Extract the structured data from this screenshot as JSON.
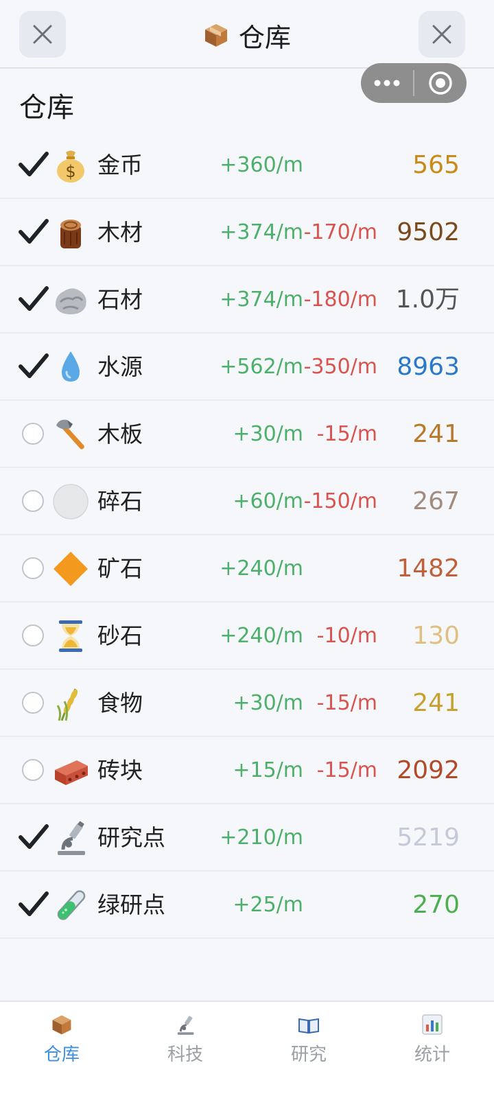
{
  "header": {
    "title": "仓库"
  },
  "section": {
    "title": "仓库"
  },
  "resources": [
    {
      "name": "金币",
      "plus": "+360/m",
      "minus": "",
      "amount": "565",
      "checked": true,
      "amount_color": "#c98a1a",
      "icon": "money-bag-icon"
    },
    {
      "name": "木材",
      "plus": "+374/m",
      "minus": "-170/m",
      "amount": "9502",
      "checked": true,
      "amount_color": "#7a4a1e",
      "icon": "wood-log-icon"
    },
    {
      "name": "石材",
      "plus": "+374/m",
      "minus": "-180/m",
      "amount": "1.0万",
      "checked": true,
      "amount_color": "#555555",
      "icon": "rock-icon"
    },
    {
      "name": "水源",
      "plus": "+562/m",
      "minus": "-350/m",
      "amount": "8963",
      "checked": true,
      "amount_color": "#2a78c8",
      "icon": "water-drop-icon"
    },
    {
      "name": "木板",
      "plus": "+30/m",
      "minus": "-15/m",
      "amount": "241",
      "checked": false,
      "amount_color": "#b8792a",
      "icon": "axe-icon"
    },
    {
      "name": "碎石",
      "plus": "+60/m",
      "minus": "-150/m",
      "amount": "267",
      "checked": false,
      "amount_color": "#a08c80",
      "icon": "white-circle-icon"
    },
    {
      "name": "矿石",
      "plus": "+240/m",
      "minus": "",
      "amount": "1482",
      "checked": false,
      "amount_color": "#c0603a",
      "icon": "orange-diamond-icon"
    },
    {
      "name": "砂石",
      "plus": "+240/m",
      "minus": "-10/m",
      "amount": "130",
      "checked": false,
      "amount_color": "#e0c080",
      "icon": "hourglass-icon"
    },
    {
      "name": "食物",
      "plus": "+30/m",
      "minus": "-15/m",
      "amount": "241",
      "checked": false,
      "amount_color": "#c8a030",
      "icon": "wheat-icon"
    },
    {
      "name": "砖块",
      "plus": "+15/m",
      "minus": "-15/m",
      "amount": "2092",
      "checked": false,
      "amount_color": "#b04a2a",
      "icon": "brick-icon"
    },
    {
      "name": "研究点",
      "plus": "+210/m",
      "minus": "",
      "amount": "5219",
      "checked": true,
      "amount_color": "#c5c9d8",
      "icon": "microscope-icon"
    },
    {
      "name": "绿研点",
      "plus": "+25/m",
      "minus": "",
      "amount": "270",
      "checked": true,
      "amount_color": "#4caf50",
      "icon": "test-tube-icon"
    }
  ],
  "nav": [
    {
      "label": "仓库",
      "icon": "box-icon",
      "active": true
    },
    {
      "label": "科技",
      "icon": "microscope-icon",
      "active": false
    },
    {
      "label": "研究",
      "icon": "book-icon",
      "active": false
    },
    {
      "label": "统计",
      "icon": "bar-chart-icon",
      "active": false
    }
  ],
  "colors": {
    "plus": "#4caf6a",
    "minus": "#d9534f",
    "accent": "#3d8fdc"
  }
}
